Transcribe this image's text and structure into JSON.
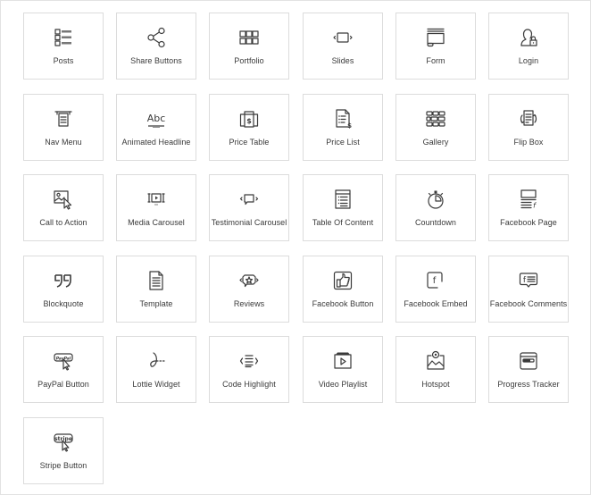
{
  "widgets": [
    {
      "label": "Posts",
      "icon": "posts-icon"
    },
    {
      "label": "Share Buttons",
      "icon": "share-icon"
    },
    {
      "label": "Portfolio",
      "icon": "portfolio-grid-icon"
    },
    {
      "label": "Slides",
      "icon": "slides-icon"
    },
    {
      "label": "Form",
      "icon": "form-icon"
    },
    {
      "label": "Login",
      "icon": "login-user-lock-icon"
    },
    {
      "label": "Nav Menu",
      "icon": "nav-menu-icon"
    },
    {
      "label": "Animated Headline",
      "icon": "animated-headline-icon"
    },
    {
      "label": "Price Table",
      "icon": "price-table-icon"
    },
    {
      "label": "Price List",
      "icon": "price-list-icon"
    },
    {
      "label": "Gallery",
      "icon": "gallery-icon"
    },
    {
      "label": "Flip Box",
      "icon": "flip-box-icon"
    },
    {
      "label": "Call to Action",
      "icon": "call-to-action-icon"
    },
    {
      "label": "Media Carousel",
      "icon": "media-carousel-icon"
    },
    {
      "label": "Testimonial Carousel",
      "icon": "testimonial-carousel-icon"
    },
    {
      "label": "Table Of Content",
      "icon": "table-of-content-icon"
    },
    {
      "label": "Countdown",
      "icon": "countdown-stopwatch-icon"
    },
    {
      "label": "Facebook Page",
      "icon": "facebook-page-icon"
    },
    {
      "label": "Blockquote",
      "icon": "blockquote-icon"
    },
    {
      "label": "Template",
      "icon": "template-document-icon"
    },
    {
      "label": "Reviews",
      "icon": "reviews-star-bubble-icon"
    },
    {
      "label": "Facebook Button",
      "icon": "facebook-like-button-icon"
    },
    {
      "label": "Facebook Embed",
      "icon": "facebook-embed-icon"
    },
    {
      "label": "Facebook Comments",
      "icon": "facebook-comments-icon"
    },
    {
      "label": "PayPal Button",
      "icon": "paypal-button-icon"
    },
    {
      "label": "Lottie Widget",
      "icon": "lottie-icon"
    },
    {
      "label": "Code Highlight",
      "icon": "code-highlight-icon"
    },
    {
      "label": "Video Playlist",
      "icon": "video-playlist-icon"
    },
    {
      "label": "Hotspot",
      "icon": "hotspot-icon"
    },
    {
      "label": "Progress Tracker",
      "icon": "progress-tracker-icon"
    },
    {
      "label": "Stripe Button",
      "icon": "stripe-button-icon"
    }
  ],
  "icon_text": {
    "animated_headline": "Abc",
    "paypal": "PayPal",
    "stripe": "stripe",
    "facebook": "f",
    "price": "$",
    "embed_code": "</>"
  },
  "colors": {
    "icon_stroke": "#3a3a3a",
    "tile_border": "#dcdcdc",
    "label_text": "#3a3a3a"
  }
}
